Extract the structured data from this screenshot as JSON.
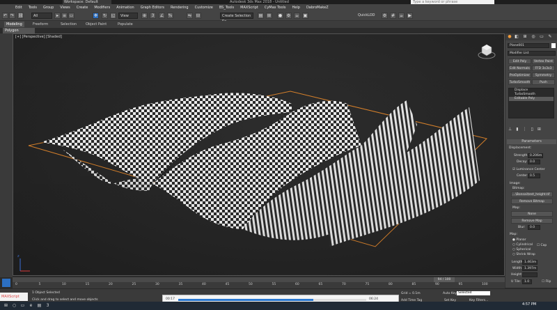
{
  "window": {
    "workspace": "Workspace: Default",
    "title": "Autodesk 3ds Max 2018 - Untitled",
    "search_placeholder": "Type a keyword or phrase"
  },
  "menu": [
    "Edit",
    "Tools",
    "Group",
    "Views",
    "Create",
    "Modifiers",
    "Animation",
    "Graph Editors",
    "Rendering",
    "Customize",
    "BS_Tools",
    "MAXScript",
    "CyMax Tools",
    "Help",
    "DabroMakeZ"
  ],
  "toolbar": {
    "filter_value": "All",
    "view_value": "View",
    "selection_set_placeholder": "Create Selection Se",
    "quick_label": "QuickLOD"
  },
  "ribbon": {
    "tabs": [
      "Modeling",
      "Freeform",
      "Selection",
      "Object Paint",
      "Populate"
    ],
    "active_tab": "Modeling",
    "sub_label": "Polygon Modeling"
  },
  "viewport": {
    "label": "[+] [Perspective] [Shaded]"
  },
  "command_panel": {
    "object_name": "Plane001",
    "modifier_list": "Modifier List",
    "modifier_buttons": [
      "Edit Poly",
      "Vertex Paint",
      "Edit Normals",
      "FFD 3x3x3",
      "ProOptimizer",
      "Symmetry",
      "TurboSmooth",
      "Push"
    ],
    "stack": [
      "Displace",
      "TurboSmooth",
      "Editable Poly"
    ],
    "stack_selected": "Editable Poly",
    "rollout_title": "Parameters",
    "displacement_label": "Displacement:",
    "strength_label": "Strength:",
    "strength_value": "0.206m",
    "decay_label": "Decay:",
    "decay_value": "0.0",
    "luminance_center": "Luminance Center",
    "center_label": "Center:",
    "center_value": "0.5",
    "image_label": "Image:",
    "bitmap_label": "Bitmap:",
    "bitmap_path": "...\\Bonsai\\test_height.tif",
    "remove_bitmap": "Remove Bitmap",
    "map_label": "Map:",
    "map_value": "None",
    "remove_map": "Remove Map",
    "blur_label": "Blur:",
    "blur_value": "0.0",
    "map_section": "Map:",
    "map_types": [
      "Planar",
      "Cylindrical",
      "Spherical",
      "Shrink Wrap"
    ],
    "cap_label": "Cap",
    "length_label": "Length:",
    "length_value": "1.463m",
    "width_label": "Width:",
    "width_value": "1.397m",
    "height_label": "Height:",
    "utile_label": "U Tile:",
    "utile_value": "1.0",
    "flip_label": "Flip"
  },
  "timeline": {
    "frame_display": "94 / 100",
    "ticks": [
      "0",
      "5",
      "10",
      "15",
      "20",
      "25",
      "30",
      "35",
      "40",
      "45",
      "50",
      "55",
      "60",
      "65",
      "70",
      "75",
      "80",
      "85",
      "90",
      "95",
      "100"
    ]
  },
  "status": {
    "selection": "1 Object Selected",
    "prompt": "Click and drag to select and move objects",
    "grid": "Grid = 0.1m",
    "add_time_tag": "Add Time Tag",
    "auto_key": "Auto Key",
    "selected_dropdown": "Selected",
    "set_key": "Set Key",
    "key_filters": "Key Filters...",
    "listener": "MAXScript"
  },
  "video_player": {
    "elapsed": "00:17",
    "total": "06:24",
    "right_time": "00:17/06:24",
    "progress_fraction": 0.72
  },
  "taskbar": {
    "clock": "4:57 PM"
  },
  "colors": {
    "accent": "#2c6fc1",
    "background": "#2b2b2b",
    "panel": "#444444"
  }
}
